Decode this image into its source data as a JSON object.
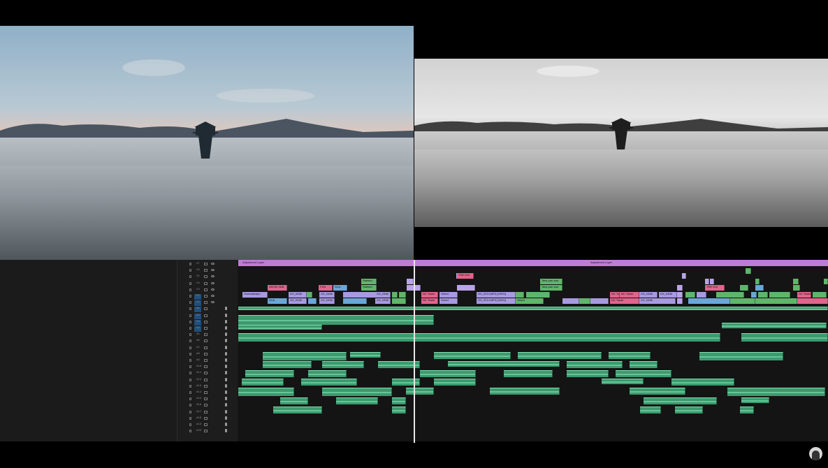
{
  "timeline": {
    "adjustment_layer_label": "Adjustment Layer",
    "tracks": [
      {
        "name": "V7"
      },
      {
        "name": "V6"
      },
      {
        "name": "V5"
      },
      {
        "name": "V4"
      },
      {
        "name": "V3"
      },
      {
        "name": "V2"
      },
      {
        "name": "V1"
      },
      {
        "name": "A1"
      },
      {
        "name": "A2"
      },
      {
        "name": "A3"
      },
      {
        "name": "A4"
      },
      {
        "name": "A5"
      },
      {
        "name": "A6"
      },
      {
        "name": "A7"
      },
      {
        "name": "A8"
      },
      {
        "name": "A9"
      },
      {
        "name": "A10"
      },
      {
        "name": "A11"
      },
      {
        "name": "A12"
      },
      {
        "name": "A13"
      },
      {
        "name": "A14"
      },
      {
        "name": "A15"
      },
      {
        "name": "A16"
      },
      {
        "name": "A17"
      },
      {
        "name": "A18"
      },
      {
        "name": "A19"
      },
      {
        "name": "A20"
      }
    ],
    "video_clips_labels": [
      "AROW 3DB",
      "SCA",
      "GX_0456",
      "FUN",
      "Stained",
      "THE GUI",
      "Tank pan swe",
      "NC Tower",
      "GX_0214.MP4 [200%]",
      "Velvet",
      "Overwatchpn"
    ]
  },
  "icons": {
    "avatar": "user-avatar-icon"
  },
  "colors": {
    "adjustment_layer": "#c07ad8",
    "audio_clip": "#3c9a6e",
    "video_purple": "#a79ae0",
    "video_pink": "#e0648c",
    "video_green": "#5fb56a",
    "playhead": "#e8e8e8"
  }
}
